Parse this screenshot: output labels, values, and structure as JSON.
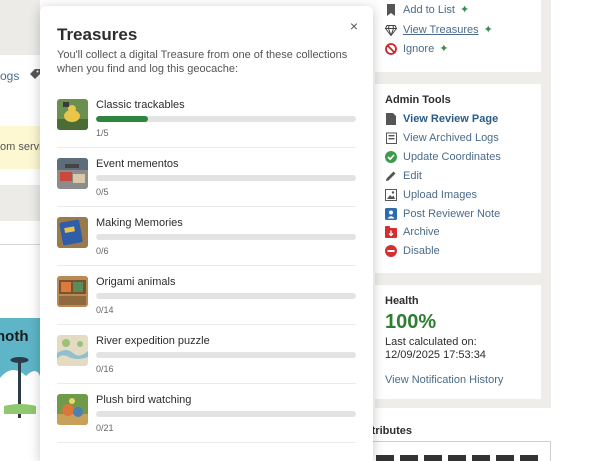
{
  "background": {
    "logs_fragment": "ogs",
    "notice_fragment": "om servic",
    "promo_fragment": "noth"
  },
  "sidebar": {
    "top_actions": [
      {
        "label": "Add to List",
        "icon": "bookmark-icon",
        "star": true
      },
      {
        "label": "View Treasures",
        "icon": "gem-icon",
        "star": true,
        "underlined": true
      },
      {
        "label": "Ignore",
        "icon": "no-entry-icon",
        "star": true
      }
    ],
    "admin": {
      "title": "Admin Tools",
      "items": [
        {
          "label": "View Review Page",
          "icon": "page-icon",
          "bold": true
        },
        {
          "label": "View Archived Logs",
          "icon": "archive-box-icon"
        },
        {
          "label": "Update Coordinates",
          "icon": "check-circle-icon"
        },
        {
          "label": "Edit",
          "icon": "pencil-icon"
        },
        {
          "label": "Upload Images",
          "icon": "image-icon"
        },
        {
          "label": "Post Reviewer Note",
          "icon": "reviewer-icon"
        },
        {
          "label": "Archive",
          "icon": "archive-icon"
        },
        {
          "label": "Disable",
          "icon": "disable-icon"
        }
      ]
    },
    "health": {
      "title": "Health",
      "value": "100%",
      "calc_label": "Last calculated on:",
      "calc_date": "12/09/2025 17:53:34",
      "history_link": "View Notification History"
    },
    "attributes_title": "ttributes"
  },
  "popover": {
    "title": "Treasures",
    "close": "×",
    "description": "You'll collect a digital Treasure from one of these collections when you find and log this geocache:",
    "items": [
      {
        "name": "Classic trackables",
        "count": "1/5",
        "progress": 0.2
      },
      {
        "name": "Event mementos",
        "count": "0/5",
        "progress": 0
      },
      {
        "name": "Making Memories",
        "count": "0/6",
        "progress": 0
      },
      {
        "name": "Origami animals",
        "count": "0/14",
        "progress": 0
      },
      {
        "name": "River expedition puzzle",
        "count": "0/16",
        "progress": 0
      },
      {
        "name": "Plush bird watching",
        "count": "0/21",
        "progress": 0
      }
    ]
  },
  "colors": {
    "accent_link": "#4a6b8a",
    "progress_fill": "#2e8540",
    "health_green": "#2e7d32",
    "sidebar_bg": "#efede9"
  }
}
